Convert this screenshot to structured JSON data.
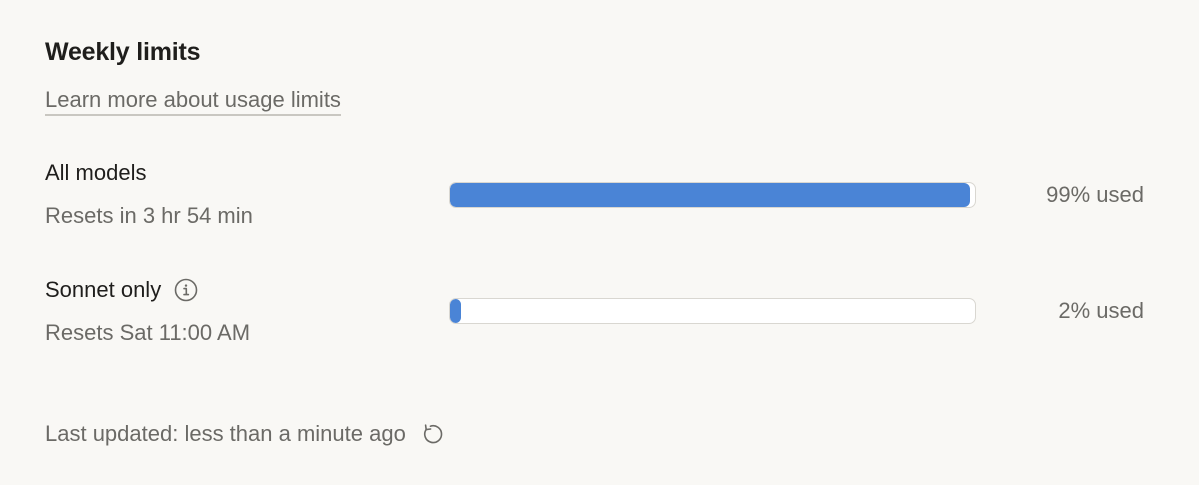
{
  "section": {
    "title": "Weekly limits",
    "learn_more_link": "Learn more about usage limits"
  },
  "limits": [
    {
      "name": "All models",
      "reset_text": "Resets in 3 hr 54 min",
      "usage_label": "99% used",
      "used_fraction": 0.99,
      "has_info_icon": false
    },
    {
      "name": "Sonnet only",
      "reset_text": "Resets Sat 11:00 AM",
      "usage_label": "2% used",
      "used_fraction": 0.02,
      "has_info_icon": true,
      "info_icon": "info-circle-icon"
    }
  ],
  "footer": {
    "last_updated_text": "Last updated: less than a minute ago",
    "refresh_icon": "refresh-icon"
  },
  "colors": {
    "background": "#f9f8f5",
    "bar_fill": "#4a84d6",
    "bar_track": "#ffffff",
    "text_primary": "#1f1e1c",
    "text_secondary": "#6b6a66"
  }
}
